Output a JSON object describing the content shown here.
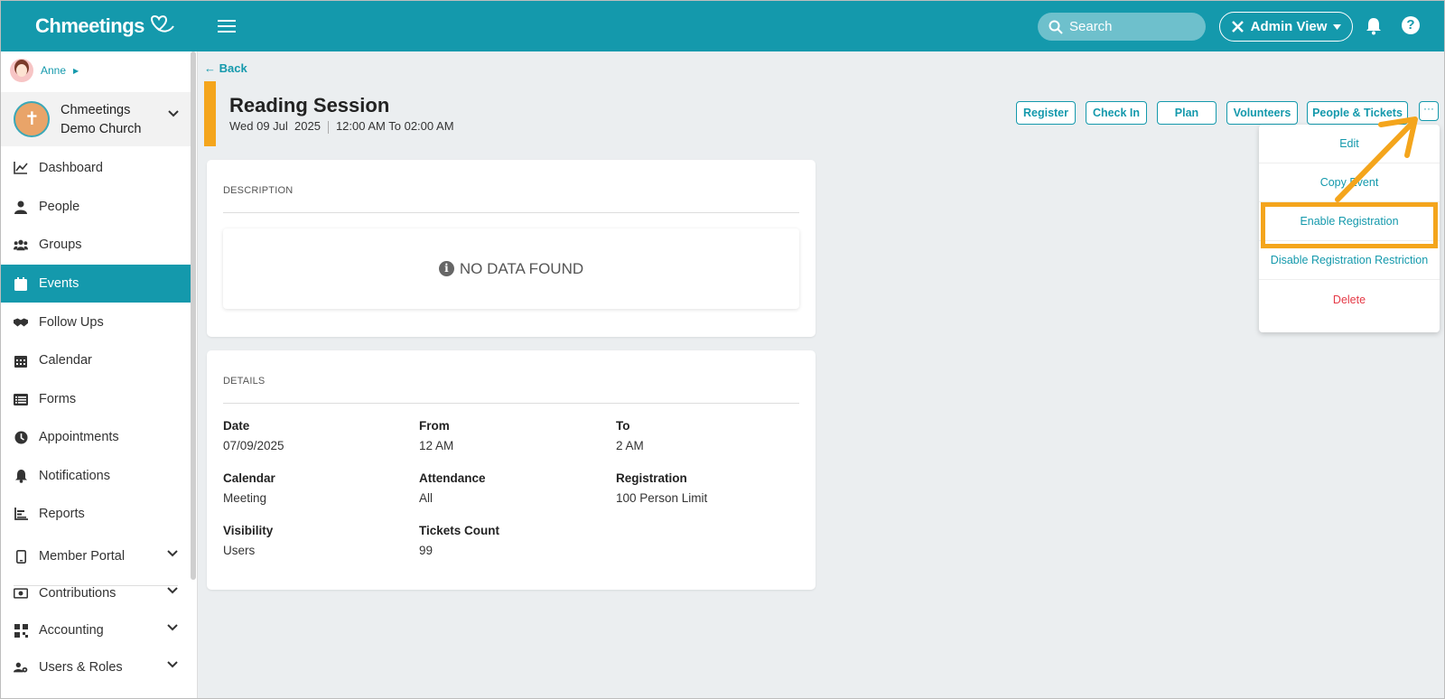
{
  "app": {
    "logo": "Chmeetings"
  },
  "header": {
    "search_placeholder": "Search",
    "admin_view_label": "Admin View",
    "help_label": "?"
  },
  "sidebar": {
    "user_name": "Anne",
    "church_name": "Chmeetings Demo Church",
    "items": [
      {
        "label": "Dashboard",
        "icon": "chart-line-icon"
      },
      {
        "label": "People",
        "icon": "person-icon"
      },
      {
        "label": "Groups",
        "icon": "users-icon"
      },
      {
        "label": "Events",
        "icon": "calendar-icon",
        "active": true
      },
      {
        "label": "Follow Ups",
        "icon": "handshake-icon"
      },
      {
        "label": "Calendar",
        "icon": "calendar-grid-icon"
      },
      {
        "label": "Forms",
        "icon": "list-icon"
      },
      {
        "label": "Appointments",
        "icon": "clock-icon"
      },
      {
        "label": "Notifications",
        "icon": "bell-icon"
      },
      {
        "label": "Reports",
        "icon": "bar-chart-icon"
      },
      {
        "label": "Member Portal",
        "icon": "phone-icon",
        "expandable": true
      },
      {
        "label": "Contributions",
        "icon": "money-icon",
        "expandable": true
      },
      {
        "label": "Accounting",
        "icon": "grid-icon",
        "expandable": true
      },
      {
        "label": "Users & Roles",
        "icon": "users-gear-icon",
        "expandable": true
      }
    ]
  },
  "page": {
    "back_label": "Back",
    "title": "Reading Session",
    "date_text": "Wed 09 Jul  2025",
    "time_text": "12:00 AM To 02:00 AM",
    "accent_color": "#f4a51c"
  },
  "actions": {
    "register": "Register",
    "check_in": "Check In",
    "plan": "Plan",
    "volunteers": "Volunteers",
    "people_tickets": "People & Tickets",
    "more": "···"
  },
  "dropdown": {
    "edit": "Edit",
    "copy_event": "Copy Event",
    "enable_registration": "Enable Registration",
    "disable_restriction": "Disable Registration Restriction",
    "delete": "Delete"
  },
  "description": {
    "heading": "DESCRIPTION",
    "empty_text": "NO DATA FOUND"
  },
  "details": {
    "heading": "DETAILS",
    "date_label": "Date",
    "date_value": "07/09/2025",
    "from_label": "From",
    "from_value": "12 AM",
    "to_label": "To",
    "to_value": "2 AM",
    "calendar_label": "Calendar",
    "calendar_value": "Meeting",
    "attendance_label": "Attendance",
    "attendance_value": "All",
    "registration_label": "Registration",
    "registration_value": "100 Person Limit",
    "visibility_label": "Visibility",
    "visibility_value": "Users",
    "tickets_label": "Tickets Count",
    "tickets_value": "99"
  },
  "colors": {
    "brand": "#1499ac",
    "highlight": "#f4a51c",
    "danger": "#e53946"
  }
}
